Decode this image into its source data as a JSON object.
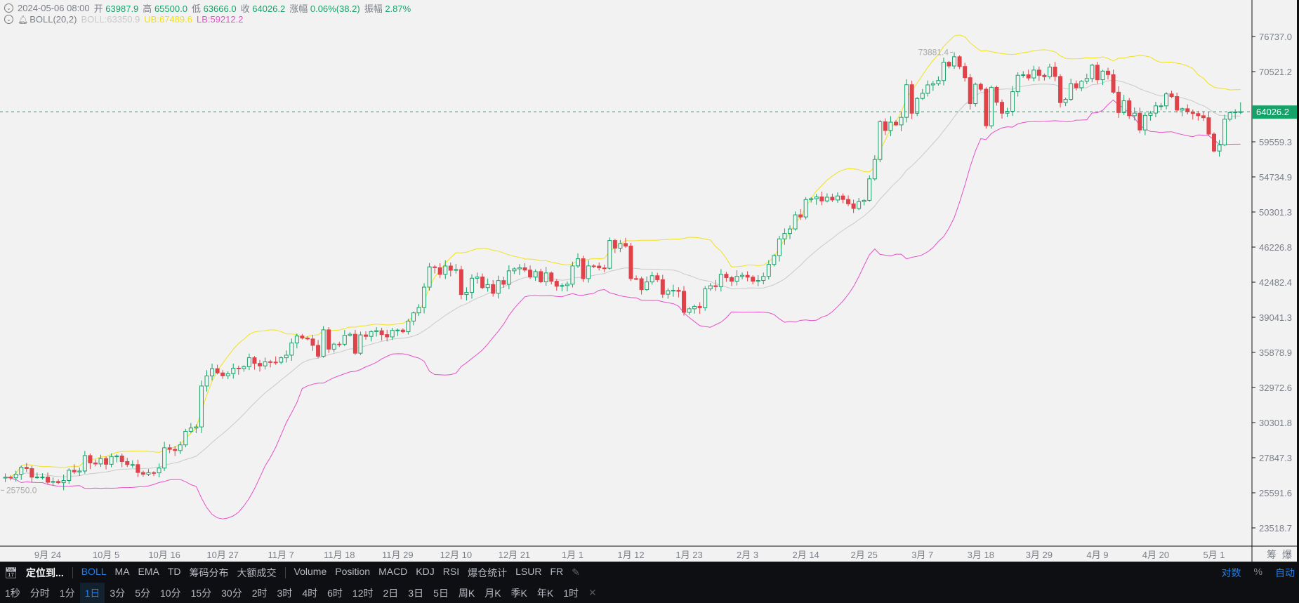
{
  "header": {
    "datetime": "2024-05-06 08:00",
    "open_label": "开",
    "open": "63987.9",
    "high_label": "高",
    "high": "65500.0",
    "low_label": "低",
    "low": "63666.0",
    "close_label": "收",
    "close": "64026.2",
    "change_label": "涨幅",
    "change": "0.06%(38.2)",
    "amplitude_label": "振幅",
    "amplitude": "2.87%"
  },
  "indicator": {
    "name": "BOLL(20,2)",
    "boll": "BOLL:63350.9",
    "ub": "UB:67489.6",
    "lb": "LB:59212.2"
  },
  "colors": {
    "up": "#16a36a",
    "down": "#e0424a",
    "mid": "#c9c9c9",
    "ub": "#f2e11a",
    "lb": "#e651c6",
    "accent": "#1f80ea"
  },
  "toolbar": {
    "locate": "定位到...",
    "main_indicators": [
      "BOLL",
      "MA",
      "EMA",
      "TD",
      "筹码分布",
      "大额成交"
    ],
    "sub_indicators": [
      "Volume",
      "Position",
      "MACD",
      "KDJ",
      "RSI",
      "爆仓统计",
      "LSUR",
      "FR"
    ],
    "log": "对数",
    "percent": "%",
    "auto": "自动"
  },
  "periods": [
    "1秒",
    "分时",
    "1分",
    "1日",
    "3分",
    "5分",
    "10分",
    "15分",
    "30分",
    "2时",
    "3时",
    "4时",
    "6时",
    "12时",
    "2日",
    "3日",
    "5日",
    "周K",
    "月K",
    "季K",
    "年K",
    "1时"
  ],
  "selected_period": "1日",
  "axis_extras": {
    "chips": "筹",
    "liq": "爆"
  },
  "chart_data": {
    "type": "candlestick",
    "start_date": "2023-09-16",
    "interval": "1d",
    "closes": [
      26570,
      26530,
      26760,
      27210,
      27130,
      26570,
      26580,
      26580,
      26250,
      26300,
      26220,
      26360,
      27020,
      26910,
      26970,
      27990,
      27500,
      27430,
      27790,
      27410,
      27930,
      27960,
      27590,
      27390,
      27390,
      26870,
      26760,
      26860,
      26850,
      27160,
      28520,
      28410,
      28330,
      28720,
      29670,
      29910,
      29990,
      33090,
      33900,
      34500,
      34150,
      33910,
      34090,
      34540,
      34500,
      34670,
      35420,
      34940,
      34730,
      35080,
      35050,
      35040,
      35420,
      35640,
      36700,
      37320,
      37140,
      37060,
      36490,
      35550,
      37880,
      36160,
      36600,
      36590,
      37390,
      37480,
      35810,
      37420,
      37290,
      37720,
      37800,
      37450,
      37240,
      37830,
      37860,
      37710,
      38690,
      39460,
      39970,
      41980,
      44080,
      43990,
      43290,
      44170,
      43720,
      43790,
      41240,
      41450,
      42890,
      43020,
      41930,
      42240,
      41360,
      42650,
      42270,
      43660,
      43870,
      43990,
      43740,
      43020,
      43580,
      42520,
      43440,
      42580,
      42070,
      42140,
      42280,
      44180,
      44950,
      42850,
      44180,
      44160,
      43970,
      43930,
      46970,
      46110,
      46630,
      46340,
      42850,
      42840,
      41730,
      42510,
      43150,
      42740,
      41270,
      41620,
      41660,
      41560,
      39510,
      39850,
      40080,
      39950,
      41810,
      42120,
      42030,
      43300,
      42950,
      42580,
      43080,
      43190,
      43000,
      42580,
      42660,
      43080,
      44340,
      45290,
      47150,
      47770,
      48290,
      49960,
      49700,
      51830,
      51940,
      52160,
      51660,
      52120,
      51780,
      52280,
      51840,
      51300,
      50730,
      51570,
      51730,
      54480,
      57080,
      62500,
      61200,
      62440,
      62030,
      63170,
      68330,
      63800,
      66110,
      66930,
      68300,
      68500,
      69020,
      72130,
      71480,
      73080,
      71400,
      69500,
      65300,
      68400,
      67600,
      61900,
      67900,
      65500,
      63800,
      64100,
      67200,
      69900,
      69990,
      69450,
      70780,
      69890,
      69650,
      71300,
      69700,
      65450,
      65970,
      68500,
      67840,
      68900,
      69360,
      71620,
      69150,
      70600,
      70010,
      67110,
      63900,
      65740,
      63420,
      63810,
      61280,
      63470,
      63820,
      64940,
      64940,
      66840,
      66410,
      64280,
      64500,
      64000,
      63750,
      63420,
      63110,
      60670,
      58250,
      59120,
      62890,
      63890,
      63987.9,
      64026.2
    ],
    "last_candle": {
      "open": 63987.9,
      "high": 65500.0,
      "low": 63666.0,
      "close": 64026.2
    },
    "max_high": 73881.4,
    "min_low": 25750.0,
    "current_price": "64026.2",
    "y_ticks": [
      "76737.0",
      "70521.2",
      "64026.2",
      "59559.3",
      "54734.9",
      "50301.3",
      "46226.8",
      "42482.4",
      "39041.3",
      "35878.9",
      "32972.6",
      "30301.8",
      "27847.3",
      "25591.6",
      "23518.7"
    ],
    "y_scale": "log",
    "x_ticks": [
      "9月 24",
      "10月 5",
      "10月 16",
      "10月 27",
      "11月 7",
      "11月 18",
      "11月 29",
      "12月 10",
      "12月 21",
      "1月 1",
      "1月 12",
      "1月 23",
      "2月 3",
      "2月 14",
      "2月 25",
      "3月 7",
      "3月 18",
      "3月 29",
      "4月 9",
      "4月 20",
      "5月 1"
    ],
    "indicator": {
      "name": "BOLL",
      "period": 20,
      "mult": 2
    }
  }
}
